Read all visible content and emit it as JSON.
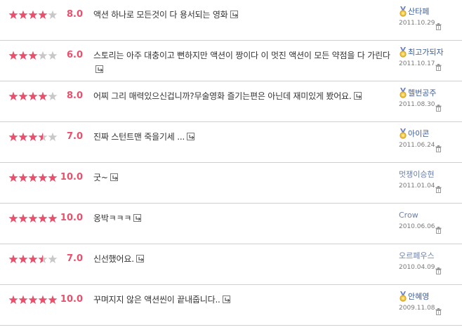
{
  "reviews": [
    {
      "rating": 4,
      "score": "8.0",
      "text": "액션 하나로 모든것이 다 용서되는 영화",
      "author": "산타페",
      "medal": true,
      "date": "2011.10.29"
    },
    {
      "rating": 3,
      "score": "6.0",
      "text": "스토리는 아주 대충이고 뻔하지만 액션이 짱이다 이 멋진 액션이 모든 약점을 다 가린다",
      "author": "최고가되자",
      "medal": true,
      "date": "2011.10.17"
    },
    {
      "rating": 4,
      "score": "8.0",
      "text": "어찌 그리 매력있으신겁니까?무술영화 즐기는편은 아닌데 재미있게 봤어요.",
      "author": "헬번공주",
      "medal": true,
      "date": "2011.08.30"
    },
    {
      "rating": 3.5,
      "score": "7.0",
      "text": "진짜 스턴트맨 죽을기세 ...",
      "author": "아이콘",
      "medal": true,
      "date": "2011.06.24"
    },
    {
      "rating": 5,
      "score": "10.0",
      "text": "굿~",
      "author": "멋쟁이승현",
      "medal": false,
      "date": "2011.01.04"
    },
    {
      "rating": 5,
      "score": "10.0",
      "text": "옹박ㅋㅋㅋ",
      "author": "Crow",
      "medal": false,
      "date": "2010.06.06"
    },
    {
      "rating": 3.5,
      "score": "7.0",
      "text": "신선했어요.",
      "author": "오르페우스",
      "medal": false,
      "date": "2010.04.09"
    },
    {
      "rating": 5,
      "score": "10.0",
      "text": "꾸며지지 않은 액션씬이 끝내줍니다..",
      "author": "안혜영",
      "medal": true,
      "date": "2009.11.08"
    }
  ],
  "icons": {
    "star": "star-icon",
    "reply": "reply-arrow-icon",
    "medal": "medal-icon",
    "delete": "trash-icon"
  },
  "colors": {
    "star_on": "#e8506c",
    "star_off": "#c8c8c8",
    "score": "#e8506c",
    "author": "#3c5d94"
  }
}
